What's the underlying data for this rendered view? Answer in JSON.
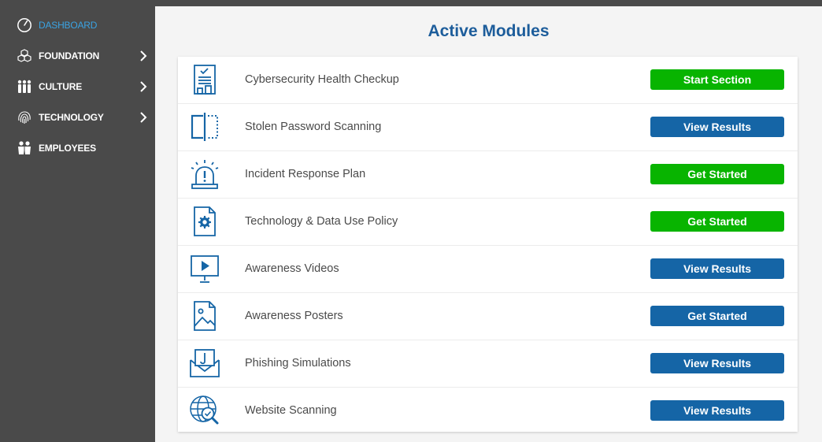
{
  "sidebar": {
    "items": [
      {
        "label": "DASHBOARD",
        "icon": "gauge-icon",
        "active": true,
        "has_submenu": false
      },
      {
        "label": "FOUNDATION",
        "icon": "cubes-icon",
        "active": false,
        "has_submenu": true
      },
      {
        "label": "CULTURE",
        "icon": "people-group-icon",
        "active": false,
        "has_submenu": true
      },
      {
        "label": "TECHNOLOGY",
        "icon": "fingerprint-icon",
        "active": false,
        "has_submenu": true
      },
      {
        "label": "EMPLOYEES",
        "icon": "employees-icon",
        "active": false,
        "has_submenu": false
      }
    ]
  },
  "main": {
    "title": "Active Modules",
    "modules": [
      {
        "name": "Cybersecurity Health Checkup",
        "icon": "clipboard-checklist-icon",
        "button": "Start Section",
        "button_color": "green"
      },
      {
        "name": "Stolen Password Scanning",
        "icon": "scanner-icon",
        "button": "View Results",
        "button_color": "blue"
      },
      {
        "name": "Incident Response Plan",
        "icon": "alarm-siren-icon",
        "button": "Get Started",
        "button_color": "green"
      },
      {
        "name": "Technology & Data Use Policy",
        "icon": "policy-document-icon",
        "button": "Get Started",
        "button_color": "green"
      },
      {
        "name": "Awareness Videos",
        "icon": "video-screen-icon",
        "button": "View Results",
        "button_color": "blue"
      },
      {
        "name": "Awareness Posters",
        "icon": "poster-image-icon",
        "button": "Get Started",
        "button_color": "blue"
      },
      {
        "name": "Phishing Simulations",
        "icon": "phishing-envelope-icon",
        "button": "View Results",
        "button_color": "blue"
      },
      {
        "name": "Website Scanning",
        "icon": "globe-search-icon",
        "button": "View Results",
        "button_color": "blue"
      }
    ]
  },
  "colors": {
    "sidebar_bg": "#4a4a4a",
    "active_nav": "#3aa3e3",
    "title": "#1d5d9b",
    "icon": "#1565a6",
    "green_button": "#08b400",
    "blue_button": "#1565a6"
  }
}
